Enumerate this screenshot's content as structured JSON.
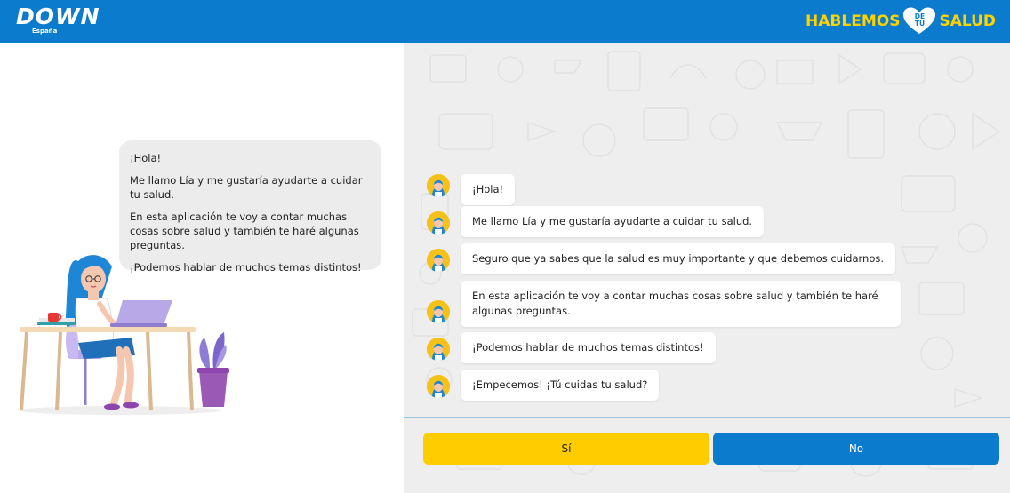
{
  "header": {
    "logo_text": "DOWN",
    "logo_sub": "España",
    "brand_left": "HABLEMOS",
    "brand_heart_top": "DE",
    "brand_heart_bottom": "TU",
    "brand_right": "SALUD",
    "bg_color": "#0b7ccd",
    "brand_color": "#ffd200"
  },
  "intro": {
    "paragraphs": [
      "¡Hola!",
      "Me llamo Lía y me gustaría ayudarte a cuidar tu salud.",
      "En esta aplicación te voy a contar muchas cosas sobre salud y también te haré algunas preguntas.",
      "¡Podemos hablar de muchos temas distintos!"
    ]
  },
  "chat": {
    "messages": [
      "¡Hola!",
      "Me llamo Lía y me gustaría ayudarte a cuidar tu salud.",
      "Seguro que ya sabes que la salud es muy importante y que debemos cuidarnos.",
      "En esta aplicación te voy a contar muchas cosas sobre salud y también te haré algunas preguntas.",
      "¡Podemos hablar de muchos temas distintos!",
      "¡Empecemos! ¡Tú cuidas tu salud?"
    ]
  },
  "answers": {
    "yes_label": "Sí",
    "no_label": "No",
    "yes_color": "#ffcc00",
    "no_color": "#0b7ccd"
  }
}
